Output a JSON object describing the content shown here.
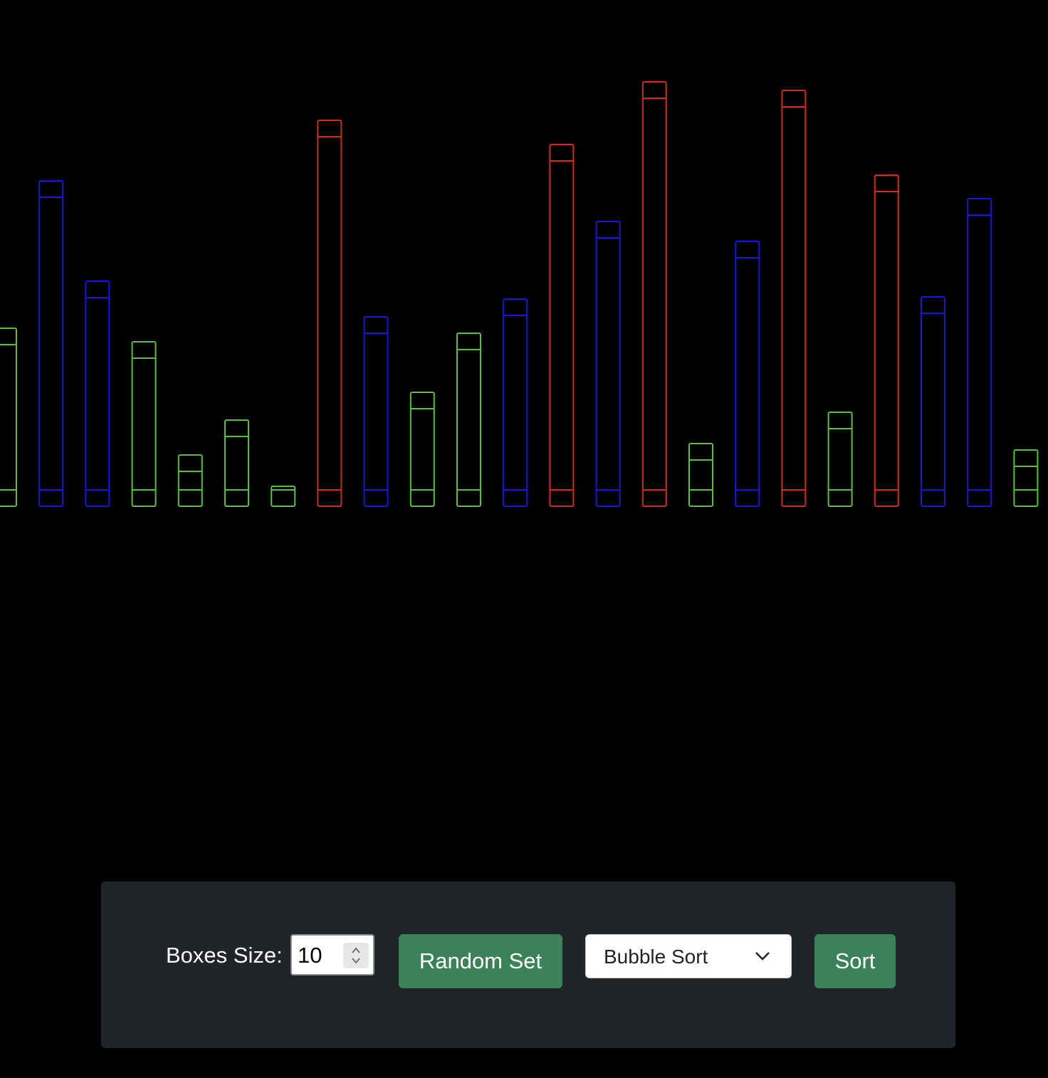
{
  "bars": {
    "colors": {
      "red": "#d8281e",
      "blue": "#1616e0",
      "green": "#55c234"
    },
    "items": [
      {
        "value": 250,
        "color": "green"
      },
      {
        "value": 457,
        "color": "blue"
      },
      {
        "value": 316,
        "color": "blue"
      },
      {
        "value": 231,
        "color": "green"
      },
      {
        "value": 72,
        "color": "green"
      },
      {
        "value": 121,
        "color": "green"
      },
      {
        "value": 28,
        "color": "green"
      },
      {
        "value": 542,
        "color": "red"
      },
      {
        "value": 266,
        "color": "blue"
      },
      {
        "value": 160,
        "color": "green"
      },
      {
        "value": 243,
        "color": "green"
      },
      {
        "value": 291,
        "color": "blue"
      },
      {
        "value": 508,
        "color": "red"
      },
      {
        "value": 400,
        "color": "blue"
      },
      {
        "value": 596,
        "color": "red"
      },
      {
        "value": 88,
        "color": "green"
      },
      {
        "value": 372,
        "color": "blue"
      },
      {
        "value": 584,
        "color": "red"
      },
      {
        "value": 132,
        "color": "green"
      },
      {
        "value": 465,
        "color": "red"
      },
      {
        "value": 294,
        "color": "blue"
      },
      {
        "value": 432,
        "color": "blue"
      },
      {
        "value": 79,
        "color": "green"
      }
    ]
  },
  "controls": {
    "size_label": "Boxes Size:",
    "size_value": "10",
    "random_label": "Random Set",
    "algorithm_selected": "Bubble Sort",
    "sort_label": "Sort",
    "button_color": "#3c8258",
    "panel_color": "#212529"
  }
}
